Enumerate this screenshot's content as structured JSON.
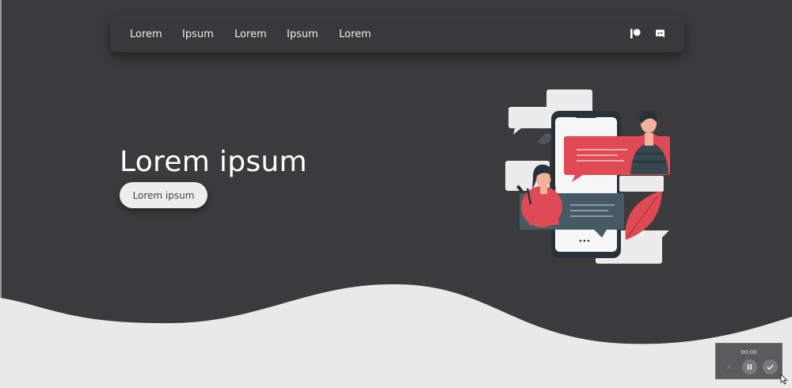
{
  "nav": {
    "links": [
      "Lorem",
      "Ipsum",
      "Lorem",
      "Ipsum",
      "Lorem"
    ],
    "icons": [
      "patreon-icon",
      "discord-icon"
    ]
  },
  "hero": {
    "title": "Lorem ipsum",
    "button_label": "Lorem ipsum",
    "illustration": "chat-messaging-illustration"
  },
  "recorder": {
    "time": "00:00",
    "buttons": [
      "cancel-icon",
      "pause-icon",
      "check-icon"
    ]
  },
  "colors": {
    "background": "#3b3a3c",
    "wave": "#e9e9e9",
    "accent": "#e04a55",
    "button": "#ededed"
  }
}
